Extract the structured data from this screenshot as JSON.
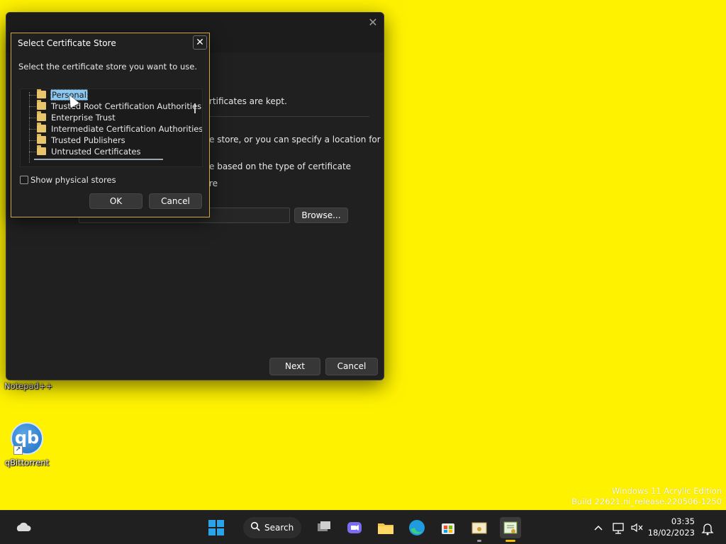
{
  "desktop": {
    "icons": [
      {
        "label": "Notepad++"
      },
      {
        "label": "qBittorrent",
        "glyph": "qb"
      }
    ],
    "watermark": [
      "Windows 11 Acrylic Edition",
      "Build 22621.ni_release.220506-1250"
    ]
  },
  "wizard": {
    "close_glyph": "✕",
    "text_fragments": [
      "rtificates are kept.",
      "e store, or you can specify a location for",
      "e based on the type of certificate",
      "re"
    ],
    "browse_label": "Browse...",
    "next_label": "Next",
    "cancel_label": "Cancel"
  },
  "cert_dialog": {
    "title": "Select Certificate Store",
    "close_glyph": "✕",
    "prompt": "Select the certificate store you want to use.",
    "stores": [
      "Personal",
      "Trusted Root Certification Authorities",
      "Enterprise Trust",
      "Intermediate Certification Authorities",
      "Trusted Publishers",
      "Untrusted Certificates"
    ],
    "selected_store": "Personal",
    "show_physical_label": "Show physical stores",
    "show_physical_checked": false,
    "ok_label": "OK",
    "cancel_label": "Cancel"
  },
  "taskbar": {
    "search_label": "Search",
    "time": "03:35",
    "date": "18/02/2023",
    "icons": [
      "weather-icon",
      "start-icon",
      "search-icon",
      "task-view-icon",
      "teams-chat-icon",
      "file-explorer-icon",
      "edge-icon",
      "store-icon",
      "certificate-manager-icon",
      "certificate-wizard-icon",
      "tray-overflow-icon",
      "network-icon",
      "volume-icon",
      "notification-icon"
    ]
  },
  "colors": {
    "desktop": "#fff200",
    "dialog_bg": "#202020",
    "focus_border": "#d4a53d",
    "selection": "#8cc8f0",
    "taskbar": "#202020",
    "active_indicator": "#f0c000"
  }
}
